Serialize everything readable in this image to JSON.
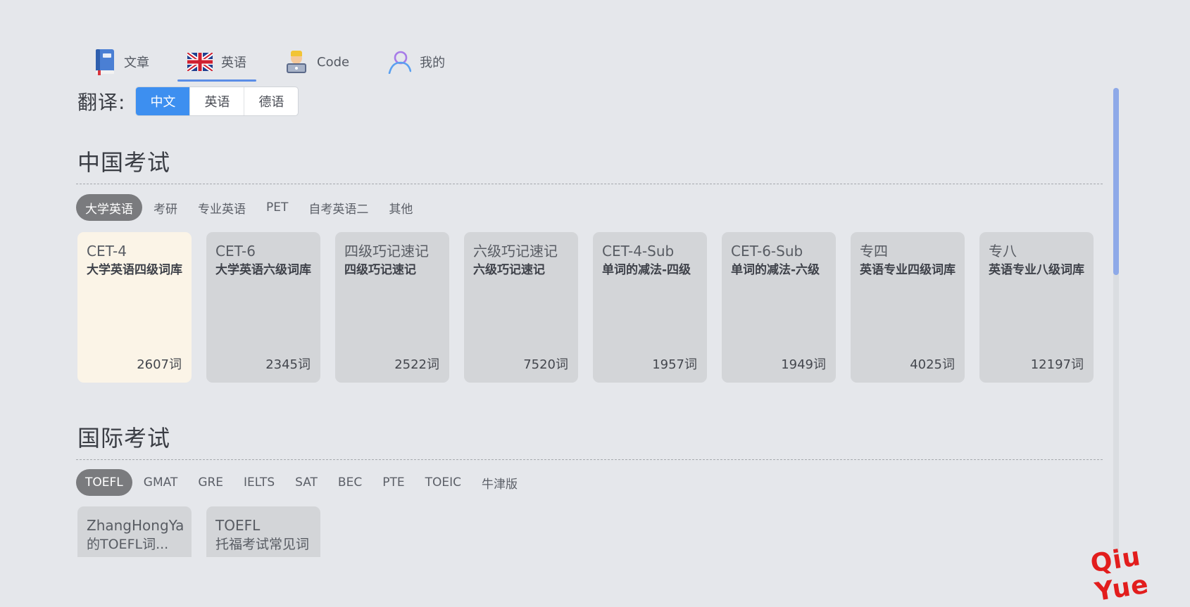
{
  "nav": {
    "tabs": [
      {
        "label": "文章",
        "icon": "book-icon"
      },
      {
        "label": "英语",
        "icon": "uk-flag-icon"
      },
      {
        "label": "Code",
        "icon": "coder-icon"
      },
      {
        "label": "我的",
        "icon": "user-icon"
      }
    ],
    "active_tab": "英语"
  },
  "translation": {
    "label": "翻译:",
    "options": [
      "中文",
      "英语",
      "德语"
    ],
    "selected": "中文"
  },
  "china_exams": {
    "title": "中国考试",
    "chips": [
      "大学英语",
      "考研",
      "专业英语",
      "PET",
      "自考英语二",
      "其他"
    ],
    "active_chip": "大学英语",
    "cards": [
      {
        "name": "CET-4",
        "desc": "大学英语四级词库",
        "count": "2607词"
      },
      {
        "name": "CET-6",
        "desc": "大学英语六级词库",
        "count": "2345词"
      },
      {
        "name": "四级巧记速记",
        "desc": "四级巧记速记",
        "count": "2522词"
      },
      {
        "name": "六级巧记速记",
        "desc": "六级巧记速记",
        "count": "7520词"
      },
      {
        "name": "CET-4-Sub",
        "desc": "单词的减法-四级",
        "count": "1957词"
      },
      {
        "name": "CET-6-Sub",
        "desc": "单词的减法-六级",
        "count": "1949词"
      },
      {
        "name": "专四",
        "desc": "英语专业四级词库",
        "count": "4025词"
      },
      {
        "name": "专八",
        "desc": "英语专业八级词库",
        "count": "12197词"
      }
    ],
    "selected_card": "CET-4"
  },
  "intl_exams": {
    "title": "国际考试",
    "chips": [
      "TOEFL",
      "GMAT",
      "GRE",
      "IELTS",
      "SAT",
      "BEC",
      "PTE",
      "TOEIC",
      "牛津版"
    ],
    "active_chip": "TOEFL",
    "cards": [
      {
        "name": "ZhangHongYa",
        "desc": "的TOEFL词..."
      },
      {
        "name": "TOEFL",
        "desc": "托福考试常见词"
      }
    ]
  },
  "watermark": "Qiu Yue",
  "colors": {
    "background": "#e5e7eb",
    "accent_blue": "#3d8ff0",
    "selected_card": "#fbf4e7",
    "card": "#d3d5d8",
    "chip_active": "#7a7b7e",
    "watermark": "#e21d1d"
  }
}
